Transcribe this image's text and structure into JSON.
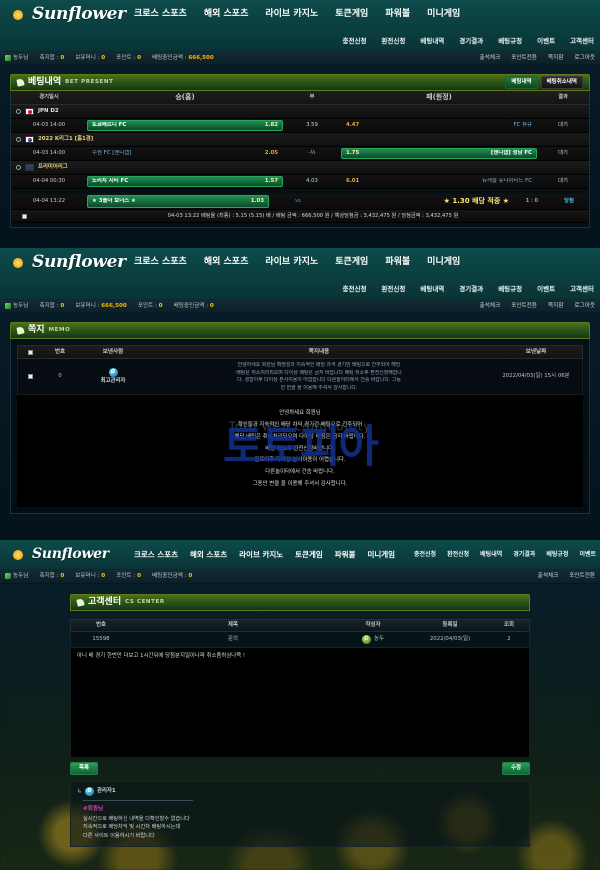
{
  "brand": {
    "name": "Sunflower",
    "logo_icon": "sun-icon"
  },
  "main_nav": [
    {
      "label": "크로스 스포츠"
    },
    {
      "label": "해외 스포츠"
    },
    {
      "label": "라이브 카지노"
    },
    {
      "label": "토큰게임"
    },
    {
      "label": "파워볼"
    },
    {
      "label": "미니게임"
    }
  ],
  "sub_nav": [
    {
      "label": "충전신청"
    },
    {
      "label": "환전신청"
    },
    {
      "label": "베팅내역"
    },
    {
      "label": "경기결과"
    },
    {
      "label": "베팅규정"
    },
    {
      "label": "이벤트"
    },
    {
      "label": "고객센터"
    }
  ],
  "infobar1": {
    "nick": "농두님",
    "items": [
      {
        "label": "축지합 :",
        "value": "0"
      },
      {
        "label": "보유머니 :",
        "value": "0"
      },
      {
        "label": "포인트 :",
        "value": "0"
      },
      {
        "label": "베팅중인금액 :",
        "value": "666,500"
      }
    ],
    "right": [
      {
        "label": "출석체크"
      },
      {
        "label": "포인트전환"
      },
      {
        "label": "쪽지함"
      },
      {
        "label": "로그아웃"
      }
    ]
  },
  "infobar2": {
    "nick": "농두님",
    "items": [
      {
        "label": "축지합 :",
        "value": "0"
      },
      {
        "label": "보유머니 :",
        "value": "666,500"
      },
      {
        "label": "포인트 :",
        "value": "0"
      },
      {
        "label": "베팅중인금액 :",
        "value": "0"
      }
    ],
    "right": [
      {
        "label": "출석체크"
      },
      {
        "label": "포인트전환"
      },
      {
        "label": "쪽지함"
      },
      {
        "label": "로그아웃"
      }
    ]
  },
  "infobar3": {
    "nick": "농두님",
    "items": [
      {
        "label": "축지합 :",
        "value": "0"
      },
      {
        "label": "보유머니 :",
        "value": "0"
      },
      {
        "label": "포인트 :",
        "value": "0"
      },
      {
        "label": "베팅중인금액 :",
        "value": "0"
      }
    ],
    "right": [
      {
        "label": "출석체크"
      },
      {
        "label": "포인트전환"
      }
    ]
  },
  "panel_bet": {
    "title_ko": "베팅내역",
    "title_en": "BET PRESENT",
    "buttons": [
      {
        "label": "베팅내역",
        "active": true
      },
      {
        "label": "베팅취소내역",
        "active": false
      }
    ],
    "columns": [
      "경기일시",
      "승(홈)",
      "무",
      "패(원정)",
      "결과"
    ],
    "groups": [
      {
        "league": "JPN D2",
        "league_flag": "jp",
        "league_color": "white",
        "rows": [
          {
            "time": "04-03 14:00",
            "home": "토쿄베르디 FC",
            "home_odds": "1.82",
            "home_picked": true,
            "draw": "3.59",
            "away_odds": "4.47",
            "away": "FC 류큐",
            "away_picked": false,
            "result": "대기"
          }
        ]
      },
      {
        "league": "2022 K리그1 [홈1경]",
        "league_flag": "kr",
        "league_color": "yellow",
        "rows": [
          {
            "time": "04-03 14:00",
            "home": "수원 FC [핸디캡]",
            "home_odds": "2.05",
            "home_picked": false,
            "draw": "-½",
            "away_odds": "1.75",
            "away": "[핸디캡] 성남 FC",
            "away_picked": true,
            "result": "대기"
          }
        ]
      },
      {
        "league": "프리미어리그",
        "league_flag": "en",
        "league_color": "yellow",
        "rows": [
          {
            "time": "04-04 00:30",
            "home": "노리치 시티 FC",
            "home_odds": "1.57",
            "home_picked": true,
            "draw": "4.03",
            "away_odds": "6.01",
            "away": "뉴캐슬 유나이티드 FC",
            "away_picked": false,
            "result": "대기"
          }
        ]
      }
    ],
    "bonus_row": {
      "time": "04-04 13:22",
      "label": "★ 3폴더 보너스 ★",
      "odds": "1.03",
      "draw": "vs",
      "away": "★ 1.30 배당 적중 ★",
      "score": "1 : 0",
      "result": "당첨"
    },
    "summary": "04-03 13:22 베팅율 (최종) : 5.15 (5.15) 배 / 베팅 금액 : 666,500 원 / 예상당첨금 : 3,432,475 원 / 당첨금액 : 3,432,475 원"
  },
  "panel_memo": {
    "title_ko": "쪽지",
    "title_en": "MEMO",
    "columns": [
      "번호",
      "보낸사람",
      "쪽지내용",
      "보낸날짜"
    ],
    "row": {
      "no": "0",
      "sender": "최고관리자",
      "sender_icon": "admin-badge-icon",
      "preview": [
        "안녕하세요 회원님 확정성과 지속적인 배당 과격 경기만 배팅으로 간주되어 해당",
        "배팅은 취소처리되오며 다이상 배팅은 금지 바랍니다 배팅 취소후 환전신청해합니",
        "다. 경합이후 다이상 본사이용이 어렵습니다 다른놀이터에서 건승 바랍니다. 그동",
        "안 한클 을 이용해 주셔서 감사합니다."
      ],
      "date": "2022/04/03(일) 15시 06분"
    },
    "body_lines": [
      "안녕하세요 회원님",
      "확인들과 지속적인 배당 차익 경기간 배팅으로 간주되어",
      "해당 배팅은 취소처리되오며 다이상 배팅은 금지 바랍니다.",
      "배팅 취소후 환전신청바랍니다.",
      "검토이후 다이상 본사이용이 어렵습니다.",
      "다른놀이터에서 건승 바랍니다.",
      "그동안 변클 을 이용해 주셔서 감사합니다."
    ],
    "watermark": "토토피아",
    "watermark_sub": "Toto web community"
  },
  "panel_cs": {
    "title_ko": "고객센터",
    "title_en": "CS CENTER",
    "columns": [
      "번호",
      "제목",
      "작성자",
      "등록일",
      "조회"
    ],
    "row": {
      "no": "15598",
      "title": "문의",
      "writer": "농두",
      "writer_icon": "user-badge-icon",
      "date": "2022/04/03(일)",
      "hits": "2"
    },
    "content": "아니 배 경기 한번만 더보고 1시간뒤에 당첨분지일이나파 취소줌하삼나쪽 !",
    "buttons": {
      "list": "목록",
      "edit": "수정"
    },
    "reply": {
      "author": "관리자1",
      "author_icon": "admin-badge-icon",
      "title": "#회원님",
      "lines": [
        "실시간으로 배팅하신 내역을 다확인할수 없습니다",
        "지속적으로 배당차익 및 시간차 배팅하시는데",
        "다른 사이트 이용하시기 바랍니다"
      ]
    }
  }
}
